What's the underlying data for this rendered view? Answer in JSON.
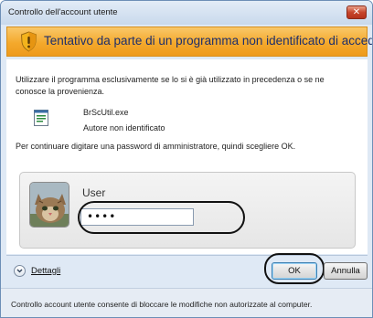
{
  "window": {
    "title": "Controllo dell'account utente",
    "close_label": "✕"
  },
  "banner": {
    "icon": "shield-icon",
    "text": "Tentativo da parte di un programma non identificato di accedere al computer"
  },
  "main": {
    "intro": "Utilizzare il programma esclusivamente se lo si è già utilizzato in precedenza o se ne conosce la provenienza.",
    "program": {
      "icon": "program-icon",
      "name": "BrScUtil.exe",
      "publisher": "Autore non identificato"
    },
    "instruction": "Per continuare digitare una password di amministratore, quindi scegliere OK."
  },
  "credentials": {
    "user_name": "User",
    "password_value": "••••",
    "avatar": "cat-avatar-image"
  },
  "actions": {
    "details_label": "Dettagli",
    "ok_label": "OK",
    "cancel_label": "Annulla"
  },
  "footer": {
    "text": "Controllo account utente consente di bloccare le modifiche non autorizzate al computer."
  },
  "colors": {
    "banner": "#f4a92c",
    "banner_text": "#1e2f6b",
    "window_frame": "#dfe9f5",
    "close_button": "#c7452b"
  }
}
